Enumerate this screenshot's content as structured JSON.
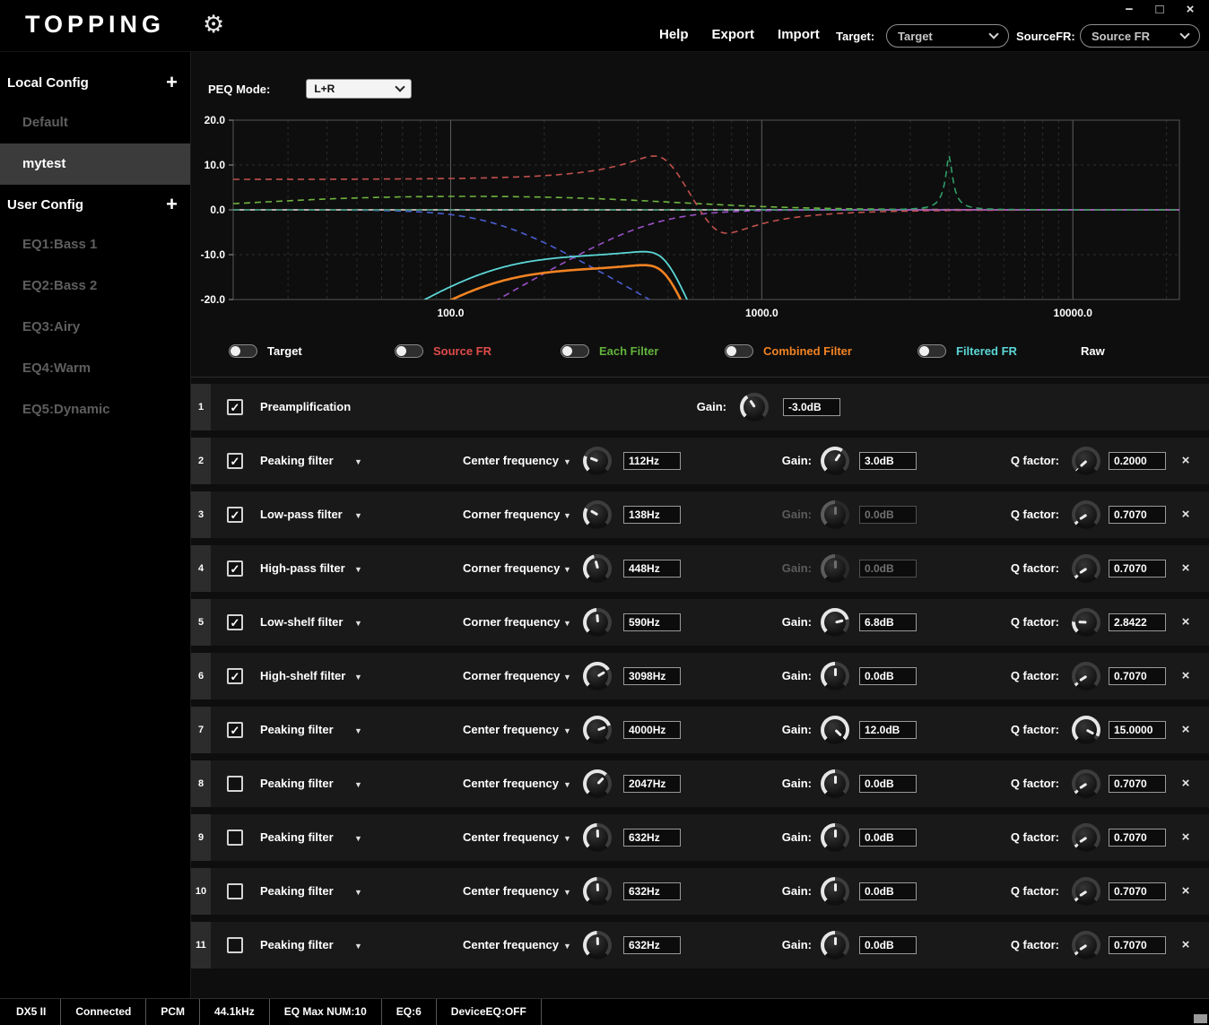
{
  "icons": {
    "gear": "⚙",
    "caret_down": "▼",
    "check": "✓",
    "remove": "×",
    "plus": "+"
  },
  "window_controls": [
    {
      "name": "minimize",
      "glyph": "−"
    },
    {
      "name": "maximize",
      "glyph": "□"
    },
    {
      "name": "close",
      "glyph": "×"
    }
  ],
  "topbar": {
    "logo": "TOPPING",
    "menu": [
      "Help",
      "Export",
      "Import"
    ],
    "target_label": "Target:",
    "target_value": "Target",
    "sourcefr_label": "SourceFR:",
    "sourcefr_value": "Source FR"
  },
  "sidebar": {
    "sections": [
      {
        "label": "Local Config",
        "items": [
          {
            "label": "Default",
            "state": "dim"
          },
          {
            "label": "mytest",
            "state": "selected"
          }
        ]
      },
      {
        "label": "User Config",
        "items": [
          {
            "label": "EQ1:Bass 1",
            "state": "dim"
          },
          {
            "label": "EQ2:Bass 2",
            "state": "dim"
          },
          {
            "label": "EQ3:Airy",
            "state": "dim"
          },
          {
            "label": "EQ4:Warm",
            "state": "dim"
          },
          {
            "label": "EQ5:Dynamic",
            "state": "dim"
          }
        ]
      }
    ]
  },
  "peq": {
    "label": "PEQ Mode:",
    "value": "L+R"
  },
  "chart_data": {
    "type": "line",
    "x_axis": {
      "scale": "log",
      "min_hz": 20,
      "max_hz": 22000,
      "tick_labels": [
        "100.0",
        "1000.0",
        "10000.0"
      ],
      "tick_hz": [
        100,
        1000,
        10000
      ]
    },
    "y_axis": {
      "min_db": -20,
      "max_db": 20,
      "tick_labels": [
        "20.0",
        "10.0",
        "0.0",
        "-10.0",
        "-20.0"
      ],
      "tick_db": [
        20,
        10,
        0,
        -10,
        -20
      ]
    },
    "grid": "log-dashed",
    "series": [
      {
        "name": "Target",
        "color": "#d9d9d9",
        "style": "solid",
        "derive": "flat-0dB"
      },
      {
        "name": "Source FR",
        "color": "#e04b4b",
        "style": "solid",
        "derive": "flat-0dB"
      },
      {
        "name": "Each Filter",
        "style": "dashed",
        "derive": "per-enabled-filter-response"
      },
      {
        "name": "Combined Filter",
        "color": "#f28322",
        "style": "solid",
        "derive": "sum-of-enabled-filters-including-preamp"
      },
      {
        "name": "Filtered FR",
        "color": "#5cd6d6",
        "style": "solid",
        "derive": "sum-of-enabled-filters-excluding-preamp"
      }
    ]
  },
  "legend": [
    {
      "label": "Target",
      "color": "#ffffff",
      "toggle": true
    },
    {
      "label": "Source FR",
      "color": "#e04b4b",
      "toggle": true
    },
    {
      "label": "Each Filter",
      "color": "#62b23c",
      "toggle": true
    },
    {
      "label": "Combined Filter",
      "color": "#f28322",
      "toggle": true
    },
    {
      "label": "Filtered FR",
      "color": "#5cd6d6",
      "toggle": true
    },
    {
      "label": "Raw",
      "color": "#ffffff",
      "toggle": false
    }
  ],
  "filter_labels": {
    "gain": "Gain:",
    "q": "Q factor:"
  },
  "filters": [
    {
      "num": "1",
      "enabled": true,
      "preamp": true,
      "type": "Preamplification",
      "kind": "preamp",
      "gain_db": -3.0,
      "gain_value": "-3.0dB",
      "gain_enabled": true
    },
    {
      "num": "2",
      "enabled": true,
      "preamp": false,
      "type": "Peaking filter",
      "kind": "peaking",
      "freq_label": "Center frequency",
      "freq_hz": 112,
      "freq_value": "112Hz",
      "gain_db": 3.0,
      "gain_value": "3.0dB",
      "gain_enabled": true,
      "q": 0.2,
      "q_value": "0.2000",
      "curve_color": "#6fb33f"
    },
    {
      "num": "3",
      "enabled": true,
      "preamp": false,
      "type": "Low-pass filter",
      "kind": "lowpass",
      "freq_label": "Corner frequency",
      "freq_hz": 138,
      "freq_value": "138Hz",
      "gain_db": 0.0,
      "gain_value": "0.0dB",
      "gain_enabled": false,
      "q": 0.707,
      "q_value": "0.7070",
      "curve_color": "#4a5ed0"
    },
    {
      "num": "4",
      "enabled": true,
      "preamp": false,
      "type": "High-pass filter",
      "kind": "highpass",
      "freq_label": "Corner frequency",
      "freq_hz": 448,
      "freq_value": "448Hz",
      "gain_db": 0.0,
      "gain_value": "0.0dB",
      "gain_enabled": false,
      "q": 0.707,
      "q_value": "0.7070",
      "curve_color": "#9a50c8"
    },
    {
      "num": "5",
      "enabled": true,
      "preamp": false,
      "type": "Low-shelf filter",
      "kind": "lowshelf",
      "freq_label": "Corner frequency",
      "freq_hz": 590,
      "freq_value": "590Hz",
      "gain_db": 6.8,
      "gain_value": "6.8dB",
      "gain_enabled": true,
      "q": 2.8422,
      "q_value": "2.8422",
      "curve_color": "#c0504d"
    },
    {
      "num": "6",
      "enabled": true,
      "preamp": false,
      "type": "High-shelf filter",
      "kind": "highshelf",
      "freq_label": "Corner frequency",
      "freq_hz": 3098,
      "freq_value": "3098Hz",
      "gain_db": 0.0,
      "gain_value": "0.0dB",
      "gain_enabled": true,
      "q": 0.707,
      "q_value": "0.7070",
      "curve_color": "#b455b4"
    },
    {
      "num": "7",
      "enabled": true,
      "preamp": false,
      "type": "Peaking filter",
      "kind": "peaking",
      "freq_label": "Center frequency",
      "freq_hz": 4000,
      "freq_value": "4000Hz",
      "gain_db": 12.0,
      "gain_value": "12.0dB",
      "gain_enabled": true,
      "q": 15.0,
      "q_value": "15.0000",
      "curve_color": "#2f9e68"
    },
    {
      "num": "8",
      "enabled": false,
      "preamp": false,
      "type": "Peaking filter",
      "kind": "peaking",
      "freq_label": "Center frequency",
      "freq_hz": 2047,
      "freq_value": "2047Hz",
      "gain_db": 0.0,
      "gain_value": "0.0dB",
      "gain_enabled": true,
      "q": 0.707,
      "q_value": "0.7070",
      "curve_color": "#6fb33f"
    },
    {
      "num": "9",
      "enabled": false,
      "preamp": false,
      "type": "Peaking filter",
      "kind": "peaking",
      "freq_label": "Center frequency",
      "freq_hz": 632,
      "freq_value": "632Hz",
      "gain_db": 0.0,
      "gain_value": "0.0dB",
      "gain_enabled": true,
      "q": 0.707,
      "q_value": "0.7070",
      "curve_color": "#6fb33f"
    },
    {
      "num": "10",
      "enabled": false,
      "preamp": false,
      "type": "Peaking filter",
      "kind": "peaking",
      "freq_label": "Center frequency",
      "freq_hz": 632,
      "freq_value": "632Hz",
      "gain_db": 0.0,
      "gain_value": "0.0dB",
      "gain_enabled": true,
      "q": 0.707,
      "q_value": "0.7070",
      "curve_color": "#6fb33f"
    },
    {
      "num": "11",
      "enabled": false,
      "preamp": false,
      "type": "Peaking filter",
      "kind": "peaking",
      "freq_label": "Center frequency",
      "freq_hz": 632,
      "freq_value": "632Hz",
      "gain_db": 0.0,
      "gain_value": "0.0dB",
      "gain_enabled": true,
      "q": 0.707,
      "q_value": "0.7070",
      "curve_color": "#6fb33f"
    }
  ],
  "statusbar": [
    "DX5 II",
    "Connected",
    "PCM",
    "44.1kHz",
    "EQ Max NUM:10",
    "EQ:6",
    "DeviceEQ:OFF"
  ]
}
